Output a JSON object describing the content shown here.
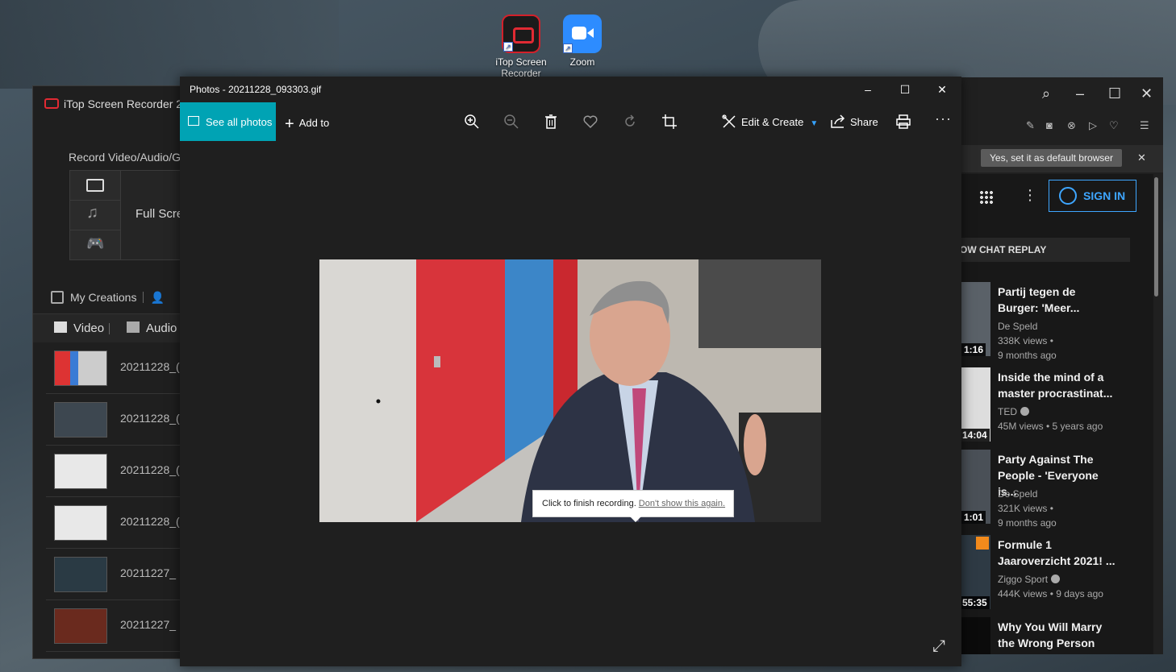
{
  "desktop": {
    "icons": [
      {
        "label": "iTop Screen Recorder",
        "icon": "itop-recorder-icon"
      },
      {
        "label": "Zoom",
        "icon": "zoom-icon"
      }
    ]
  },
  "itop": {
    "title": "iTop Screen Recorder 2",
    "record_label": "Record Video/Audio/G",
    "mode_label": "Full Scre",
    "my_creations": "My Creations",
    "tabs": [
      "Video",
      "Audio"
    ],
    "files": [
      "20211228_(",
      "20211228_(",
      "20211228_(",
      "20211228_(",
      "20211227_",
      "20211227_"
    ]
  },
  "photos": {
    "title": "Photos - 20211228_093303.gif",
    "toolbar": {
      "see_all": "See all photos",
      "add_to": "Add to",
      "edit_create": "Edit & Create",
      "share": "Share"
    },
    "tooltip": {
      "text": "Click to finish recording.",
      "link": "Don't show this again."
    }
  },
  "browser": {
    "default_button": "Yes, set it as default browser",
    "sign_in": "SIGN IN",
    "chat_replay": "OW CHAT REPLAY",
    "videos": [
      {
        "title": "Partij tegen de Burger: 'Meer...",
        "channel": "De Speld",
        "views": "338K views •",
        "age": "9 months ago",
        "duration": "1:16",
        "verified": false
      },
      {
        "title": "Inside the mind of a master procrastinat...",
        "channel": "TED",
        "views": "45M views • 5 years ago",
        "age": "",
        "duration": "14:04",
        "verified": true
      },
      {
        "title": "Party Against The People - 'Everyone is...",
        "channel": "De Speld",
        "views": "321K views •",
        "age": "9 months ago",
        "duration": "1:01",
        "verified": false
      },
      {
        "title": "Formule 1 Jaaroverzicht 2021! ...",
        "channel": "Ziggo Sport",
        "views": "444K views • 9 days ago",
        "age": "",
        "duration": "55:35",
        "verified": true
      },
      {
        "title": "Why You Will Marry the Wrong Person",
        "channel": "",
        "views": "",
        "age": "",
        "duration": "",
        "verified": false
      }
    ]
  }
}
